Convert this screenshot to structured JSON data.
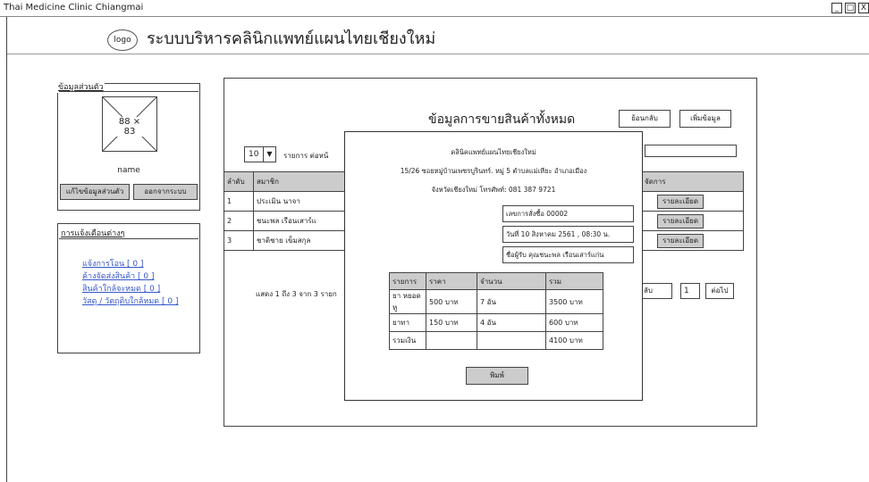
{
  "window": {
    "title": "Thai Medicine Clinic Chiangmai",
    "min": "_",
    "max": "□",
    "close": "X"
  },
  "header": {
    "logo": "logo",
    "title": "ระบบบริหารคลินิกแพทย์แผนไทยเชียงใหม่"
  },
  "profile": {
    "section_label": "ข้อมูลส่วนตัว",
    "image_placeholder": "88 × 83",
    "name": "name",
    "edit_button": "แก้ไขข้อมูลส่วนตัว",
    "logout_button": "ออกจากระบบ"
  },
  "alerts": {
    "section_label": "การแจ้งเตือนต่างๆ",
    "items": [
      "แจ้งการโอน [ 0 ]",
      "ค้างจัดส่งสินค้า [ 0 ]",
      "สินค้าใกล้จะหมด [ 0 ]",
      "วัสดุ / วัตถุดิบใกล้หมด [ 0 ]"
    ]
  },
  "main": {
    "title": "ข้อมูลการขายสินค้าทั้งหมด",
    "back_button": "ย้อนกลับ",
    "add_button": "เพิ่มข้อมูล",
    "page_size": "10",
    "page_size_suffix": "รายการ ต่อหน้",
    "columns": [
      "ลำดับ",
      "สมาชิก",
      "จัดการ"
    ],
    "rows": [
      {
        "no": "1",
        "member": "ประเมิน นาจา",
        "action": "รายละเอียด"
      },
      {
        "no": "2",
        "member": "ชนะพล เรือนเสาร์แ",
        "action": "รายละเอียด"
      },
      {
        "no": "3",
        "member": "ชาติชาย เข็มสกุล",
        "action": "รายละเอียด"
      }
    ],
    "summary": "แสดง 1 ถึง 3 จาก 3 รายก",
    "prev": "ลับ",
    "page": "1",
    "next": "ต่อไป"
  },
  "receipt": {
    "clinic": "คลินิคแพทย์แผนไทยเชียงใหม่",
    "address": "15/26 ซอยหมู่บ้านเพชรบูรินทร์. หมู่ 5 ตำบลแม่เหียะ อำเภอเมือง",
    "address2": "จังหวัดเชียงใหม่ โทรศัพท์: 081 387 9721",
    "order_no": "เลขการสั่งซื้อ 00002",
    "date": "วันที่ 10 สิงหาคม 2561 , 08:30 น.",
    "recipient": "ชื่อผู้รับ คุณชนะพล เรือนเสาร์แก่น",
    "columns": [
      "รายการ",
      "ราคา",
      "จำนวน",
      "รวม"
    ],
    "items": [
      {
        "name": "ยา หยอดหู",
        "price": "500 บาท",
        "qty": "7 อัน",
        "total": "3500 บาท"
      },
      {
        "name": "ยาทา",
        "price": "150 บาท",
        "qty": "4 อัน",
        "total": "600 บาท"
      }
    ],
    "total_label": "รวมเงิน",
    "total": "4100 บาท",
    "print_button": "พิมพ์"
  }
}
